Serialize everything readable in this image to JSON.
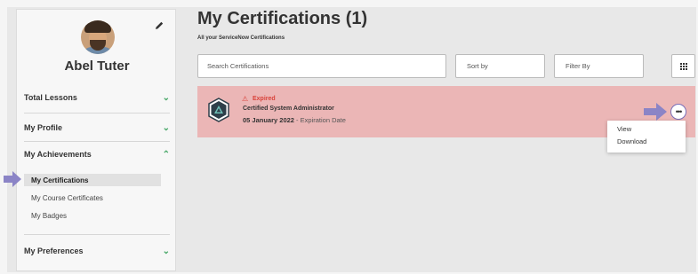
{
  "sidebar": {
    "user_name": "Abel Tuter",
    "menu": [
      {
        "label": "Total Lessons",
        "chevron": "chevron-down-icon"
      },
      {
        "label": "My Profile",
        "chevron": "chevron-down-icon"
      },
      {
        "label": "My Achievements",
        "chevron": "chevron-up-icon"
      },
      {
        "label": "My Preferences",
        "chevron": "chevron-down-icon"
      }
    ],
    "achievements_items": [
      {
        "label": "My Certifications",
        "active": true
      },
      {
        "label": "My Course Certificates",
        "active": false
      },
      {
        "label": "My Badges",
        "active": false
      }
    ]
  },
  "main": {
    "title": "My Certifications (1)",
    "subtitle": "All your ServiceNow Certifications",
    "search": {
      "placeholder": "Search Certifications"
    },
    "sort": {
      "label": "Sort by"
    },
    "filter": {
      "label": "Filter By"
    },
    "certifications": [
      {
        "status": "Expired",
        "name": "Certified System Administrator",
        "date": "05 January 2022",
        "date_suffix": " - Expiration Date"
      }
    ],
    "menu_options": [
      "View",
      "Download"
    ]
  },
  "colors": {
    "card_expired": "#ebb6b6",
    "expired_text": "#d9423a",
    "chevron": "#48a868",
    "arrow": "#8b84c6"
  }
}
